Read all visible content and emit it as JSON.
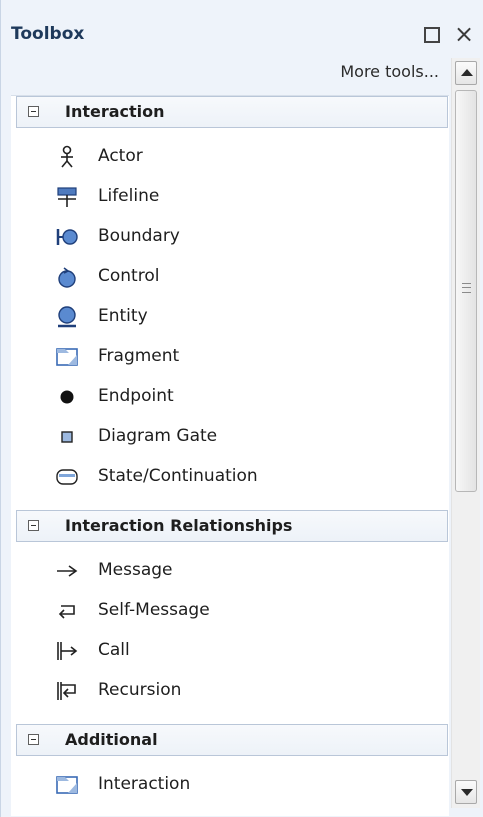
{
  "window": {
    "title": "Toolbox",
    "maximize_icon": "maximize-icon",
    "close_icon": "close-icon"
  },
  "toolbar": {
    "more_tools_label": "More tools..."
  },
  "groups": [
    {
      "label": "Interaction",
      "items": [
        {
          "label": "Actor",
          "icon": "actor-icon"
        },
        {
          "label": "Lifeline",
          "icon": "lifeline-icon"
        },
        {
          "label": "Boundary",
          "icon": "boundary-icon"
        },
        {
          "label": "Control",
          "icon": "control-icon"
        },
        {
          "label": "Entity",
          "icon": "entity-icon"
        },
        {
          "label": "Fragment",
          "icon": "fragment-icon"
        },
        {
          "label": "Endpoint",
          "icon": "endpoint-icon"
        },
        {
          "label": "Diagram Gate",
          "icon": "diagram-gate-icon"
        },
        {
          "label": "State/Continuation",
          "icon": "state-continuation-icon"
        }
      ]
    },
    {
      "label": "Interaction Relationships",
      "items": [
        {
          "label": "Message",
          "icon": "message-arrow-icon"
        },
        {
          "label": "Self-Message",
          "icon": "self-message-icon"
        },
        {
          "label": "Call",
          "icon": "call-icon"
        },
        {
          "label": "Recursion",
          "icon": "recursion-icon"
        }
      ]
    },
    {
      "label": "Additional",
      "items": [
        {
          "label": "Interaction",
          "icon": "interaction-frame-icon"
        }
      ]
    }
  ],
  "colors": {
    "panel_bg": "#eef3fa",
    "group_border": "#b9c6d8",
    "title_color": "#1e395b"
  }
}
